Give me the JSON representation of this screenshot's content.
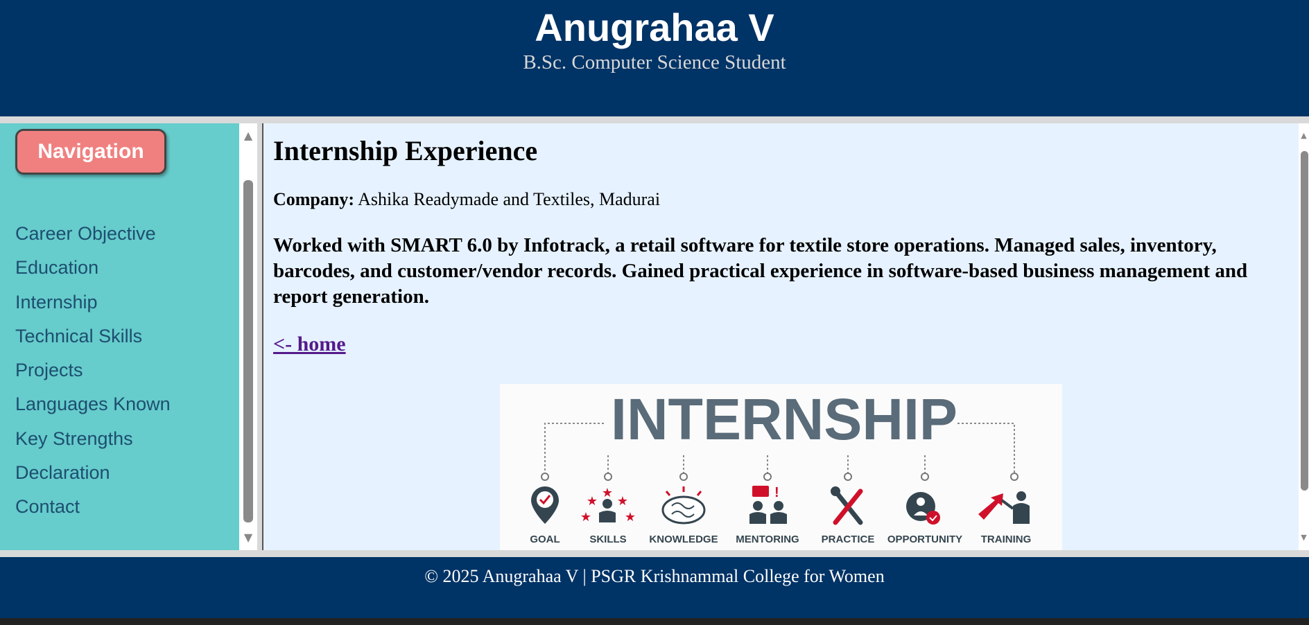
{
  "header": {
    "title": "Anugrahaa V",
    "subtitle": "B.Sc. Computer Science Student"
  },
  "sidebar": {
    "nav_button_label": "Navigation",
    "items": [
      {
        "label": "Career Objective"
      },
      {
        "label": "Education"
      },
      {
        "label": "Internship"
      },
      {
        "label": "Technical Skills"
      },
      {
        "label": "Projects"
      },
      {
        "label": "Languages Known"
      },
      {
        "label": "Key Strengths"
      },
      {
        "label": "Declaration"
      },
      {
        "label": "Contact"
      }
    ]
  },
  "main": {
    "heading": "Internship Experience",
    "company_label": "Company:",
    "company_value": "Ashika Readymade and Textiles, Madurai",
    "description": "Worked with SMART 6.0 by Infotrack, a retail software for textile store operations. Managed sales, inventory, barcodes, and customer/vendor records. Gained practical experience in software-based business management and report generation.",
    "home_link": "<- home",
    "image": {
      "title": "INTERNSHIP",
      "items": [
        "GOAL",
        "SKILLS",
        "KNOWLEDGE",
        "MENTORING",
        "PRACTICE",
        "OPPORTUNITY",
        "TRAINING"
      ]
    }
  },
  "footer": {
    "text": "© 2025 Anugrahaa V | PSGR Krishnammal College for Women"
  },
  "colors": {
    "header_bg": "#003366",
    "sidebar_bg": "#66cccc",
    "nav_button_bg": "#f08080",
    "nav_link": "#1d4e6f",
    "main_bg": "#e6f2ff",
    "visited_link": "#551a8b",
    "graphic_gray": "#5a6b79",
    "graphic_red": "#d0102a"
  }
}
